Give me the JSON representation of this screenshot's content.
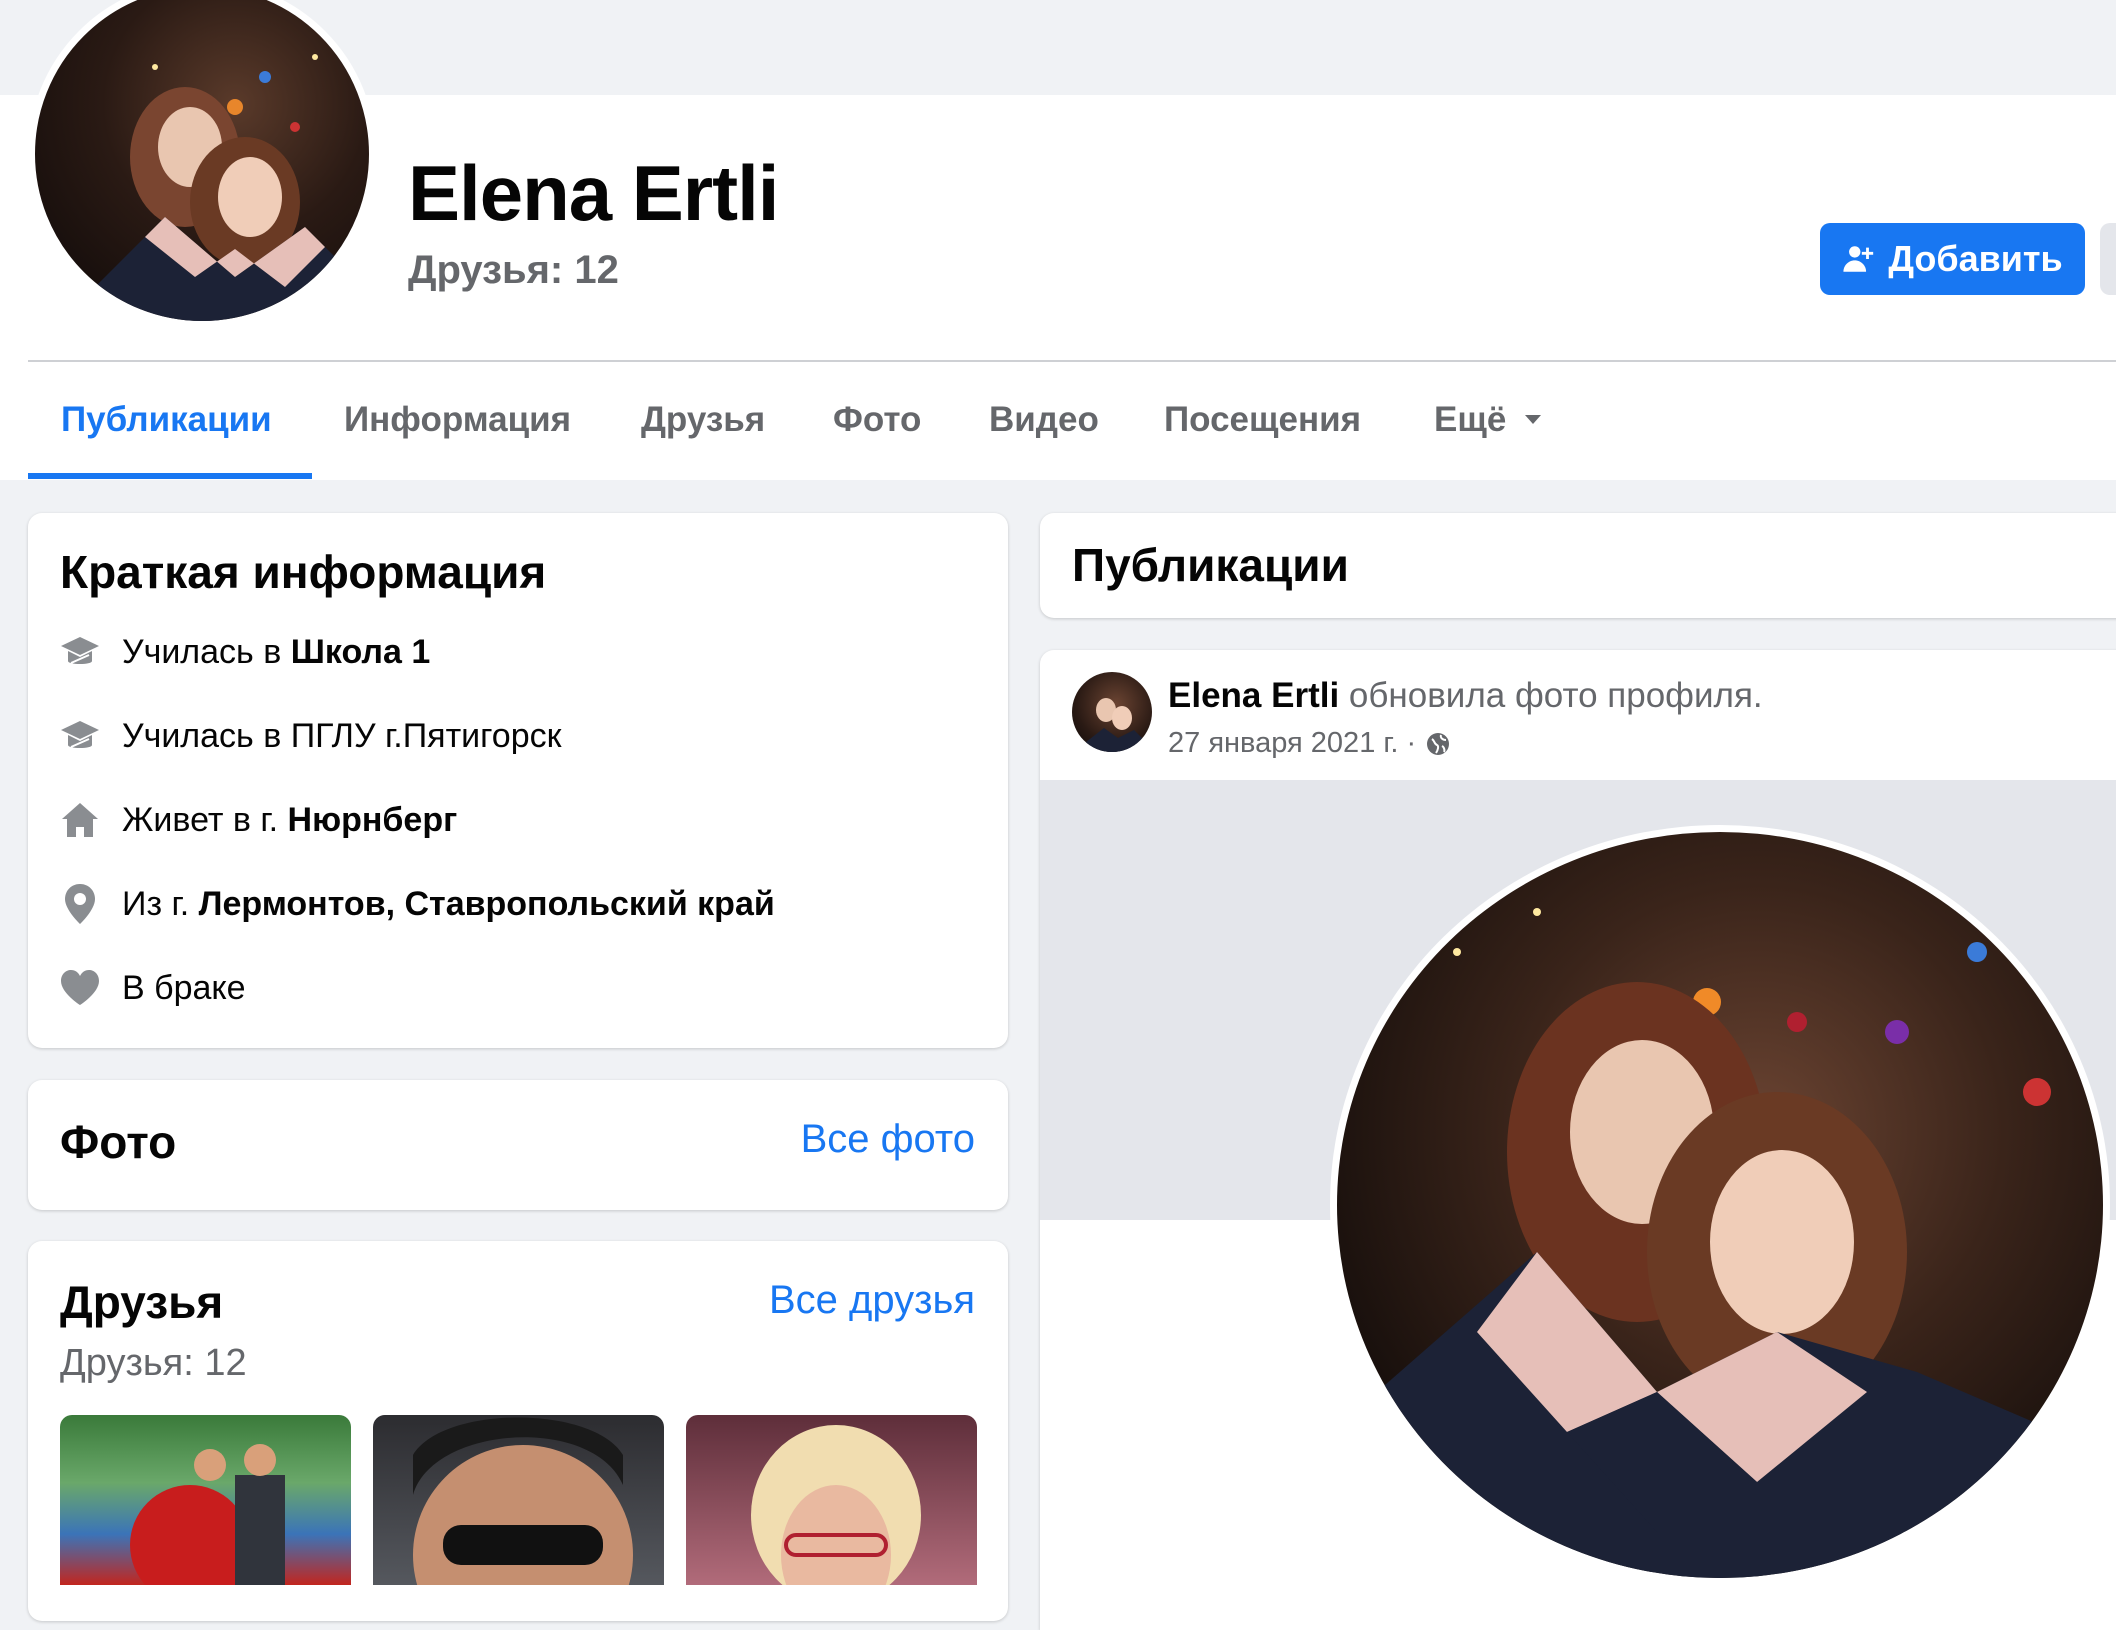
{
  "profile": {
    "name": "Elena Ertli",
    "friends_count_label": "Друзья: 12",
    "add_button_label": "Добавить"
  },
  "tabs": [
    {
      "label": "Публикации",
      "active": true
    },
    {
      "label": "Информация"
    },
    {
      "label": "Друзья"
    },
    {
      "label": "Фото"
    },
    {
      "label": "Видео"
    },
    {
      "label": "Посещения"
    },
    {
      "label": "Ещё"
    }
  ],
  "intro": {
    "title": "Краткая информация",
    "items": [
      {
        "icon": "graduation-cap-icon",
        "prefix": "Училась в ",
        "bold": "Школа 1"
      },
      {
        "icon": "graduation-cap-icon",
        "prefix": "Училась в ПГЛУ г.Пятигорск",
        "bold": ""
      },
      {
        "icon": "home-icon",
        "prefix": "Живет в г. ",
        "bold": "Нюрнберг"
      },
      {
        "icon": "location-pin-icon",
        "prefix": "Из г. ",
        "bold": "Лермонтов, Ставропольский край"
      },
      {
        "icon": "heart-icon",
        "prefix": "В браке",
        "bold": ""
      }
    ]
  },
  "photos": {
    "title": "Фото",
    "link": "Все фото"
  },
  "friends": {
    "title": "Друзья",
    "link": "Все друзья",
    "count_label": "Друзья: 12"
  },
  "posts": {
    "title": "Публикации",
    "post": {
      "author": "Elena Ertli",
      "action": "обновила фото профиля.",
      "date": "27 января 2021 г. ·"
    }
  },
  "colors": {
    "accent": "#1877f2",
    "background": "#f0f2f5",
    "secondary_text": "#65676b"
  }
}
